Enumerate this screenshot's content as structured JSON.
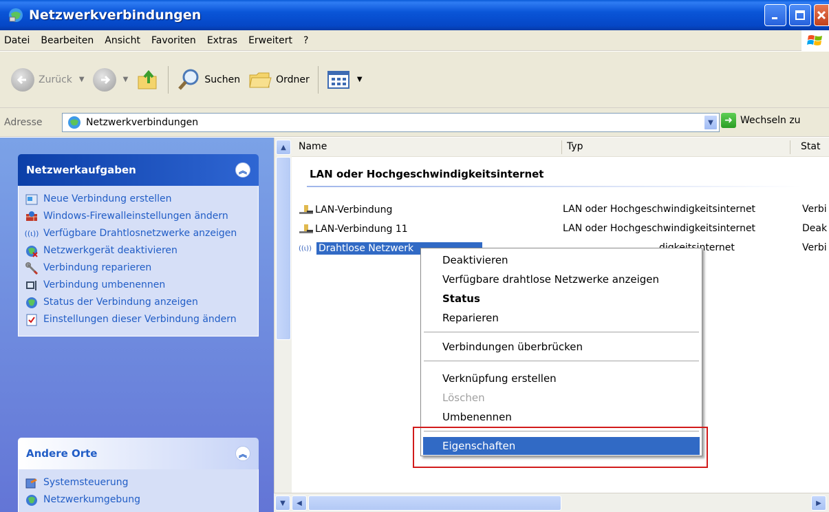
{
  "window": {
    "title": "Netzwerkverbindungen"
  },
  "menubar": {
    "items": [
      "Datei",
      "Bearbeiten",
      "Ansicht",
      "Favoriten",
      "Extras",
      "Erweitert",
      "?"
    ]
  },
  "toolbar": {
    "back_label": "Zurück",
    "search_label": "Suchen",
    "folders_label": "Ordner"
  },
  "address": {
    "label": "Adresse",
    "value": "Netzwerkverbindungen",
    "go_label": "Wechseln zu"
  },
  "left_pane": {
    "network_tasks": {
      "title": "Netzwerkaufgaben",
      "items": [
        "Neue Verbindung erstellen",
        "Windows-Firewalleinstellungen ändern",
        "Verfügbare Drahtlosnetzwerke anzeigen",
        "Netzwerkgerät deaktivieren",
        "Verbindung reparieren",
        "Verbindung umbenennen",
        "Status der Verbindung anzeigen",
        "Einstellungen dieser Verbindung ändern"
      ]
    },
    "other_places": {
      "title": "Andere Orte",
      "items": [
        "Systemsteuerung",
        "Netzwerkumgebung"
      ]
    }
  },
  "list": {
    "columns": {
      "name": "Name",
      "type": "Typ",
      "status": "Stat"
    },
    "group_title": "LAN oder Hochgeschwindigkeitsinternet",
    "rows": [
      {
        "name": "LAN-Verbindung",
        "type": "LAN oder Hochgeschwindigkeitsinternet",
        "status": "Verbi"
      },
      {
        "name": "LAN-Verbindung 11",
        "type": "LAN oder Hochgeschwindigkeitsinternet",
        "status": "Deak"
      },
      {
        "name": "Drahtlose Netzwerk",
        "type": "digkeitsinternet",
        "status": "Verbi"
      }
    ]
  },
  "context_menu": {
    "items": [
      "Deaktivieren",
      "Verfügbare drahtlose Netzwerke anzeigen",
      "Status",
      "Reparieren",
      "Verbindungen überbrücken",
      "Verknüpfung erstellen",
      "Löschen",
      "Umbenennen",
      "Eigenschaften"
    ]
  },
  "colors": {
    "selection": "#316ac5",
    "highlight_box": "#d11a1a",
    "task_link": "#215dc6"
  }
}
